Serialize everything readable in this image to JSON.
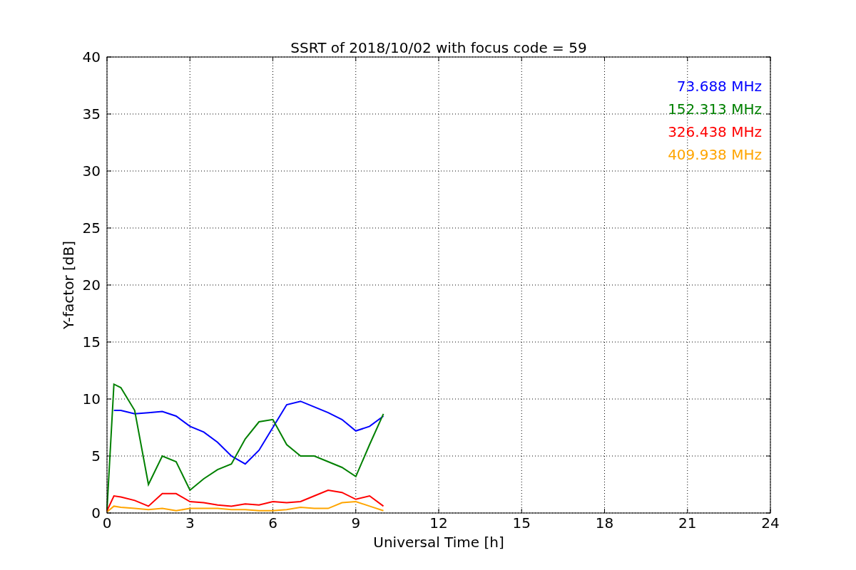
{
  "chart_data": {
    "type": "line",
    "title": "SSRT of 2018/10/02 with focus code = 59",
    "xlabel": "Universal Time [h]",
    "ylabel": "Y-factor [dB]",
    "x": [
      0,
      0.25,
      0.5,
      1,
      1.5,
      2,
      2.5,
      3,
      3.5,
      4,
      4.5,
      5,
      5.5,
      6,
      6.5,
      7,
      7.5,
      8,
      8.5,
      9,
      9.5,
      10
    ],
    "series": [
      {
        "name": "73.688 MHz",
        "color": "#0000ff",
        "values": [
          null,
          9,
          9,
          8.7,
          8.8,
          8.9,
          8.5,
          7.6,
          7.1,
          6.2,
          5,
          4.3,
          5.5,
          7.5,
          9.5,
          9.8,
          9.3,
          8.8,
          8.2,
          7.2,
          7.6,
          8.5
        ]
      },
      {
        "name": "152.313 MHz",
        "color": "#008000",
        "values": [
          0.3,
          11.3,
          11,
          9,
          2.5,
          5,
          4.5,
          2,
          3,
          3.8,
          4.3,
          6.5,
          8,
          8.2,
          6,
          5,
          5,
          4.5,
          4,
          3.2,
          6,
          8.7
        ]
      },
      {
        "name": "326.438 MHz",
        "color": "#ff0000",
        "values": [
          0.2,
          1.5,
          1.4,
          1.1,
          0.6,
          1.7,
          1.7,
          1,
          0.9,
          0.7,
          0.6,
          0.8,
          0.7,
          1,
          0.9,
          1,
          1.5,
          2,
          1.8,
          1.2,
          1.5,
          0.6
        ]
      },
      {
        "name": "409.938 MHz",
        "color": "#ffa500",
        "values": [
          0.1,
          0.6,
          0.5,
          0.4,
          0.3,
          0.4,
          0.2,
          0.4,
          0.4,
          0.4,
          0.3,
          0.3,
          0.2,
          0.2,
          0.3,
          0.5,
          0.4,
          0.4,
          0.9,
          1,
          0.6,
          0.2
        ]
      }
    ],
    "grid": true,
    "xlim": [
      0,
      24
    ],
    "ylim": [
      0,
      40
    ],
    "xticks": [
      0,
      3,
      6,
      9,
      12,
      15,
      18,
      21,
      24
    ],
    "yticks": [
      0,
      5,
      10,
      15,
      20,
      25,
      30,
      35,
      40
    ]
  }
}
